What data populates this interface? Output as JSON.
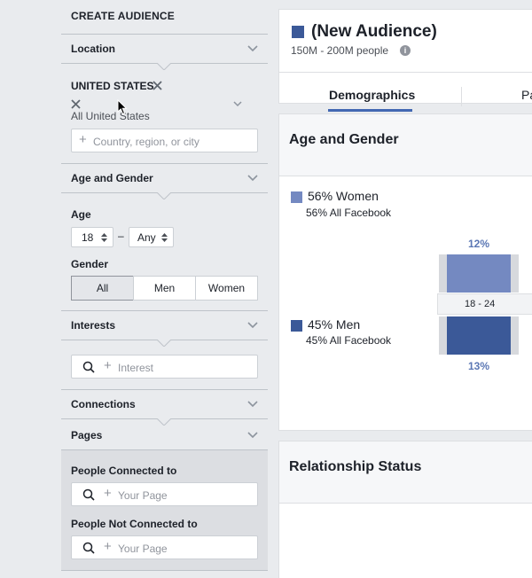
{
  "sidebar": {
    "title": "CREATE AUDIENCE",
    "location": {
      "header": "Location",
      "country": "UNITED STATES",
      "scope": "All United States",
      "placeholder": "Country, region, or city"
    },
    "age_gender": {
      "header": "Age and Gender",
      "age_label": "Age",
      "age_min": "18",
      "age_separator": "–",
      "age_max": "Any",
      "gender_label": "Gender",
      "gender_options": [
        "All",
        "Men",
        "Women"
      ],
      "gender_selected": "All"
    },
    "interests": {
      "header": "Interests",
      "placeholder": "Interest"
    },
    "connections": {
      "header": "Connections"
    },
    "pages": {
      "header": "Pages",
      "connected_label": "People Connected to",
      "connected_placeholder": "Your Page",
      "not_connected_label": "People Not Connected to",
      "not_connected_placeholder": "Your Page"
    }
  },
  "audience": {
    "name": "(New Audience)",
    "size": "150M - 200M people",
    "info_glyph": "i",
    "tabs": [
      "Demographics",
      "Pa"
    ],
    "active_tab": "Demographics"
  },
  "age_gender_card": {
    "title": "Age and Gender",
    "women": {
      "label": "56% Women",
      "sub": "56% All Facebook",
      "color": "#7489c1"
    },
    "men": {
      "label": "45% Men",
      "sub": "45% All Facebook",
      "color": "#3b5998"
    },
    "age_band": "18 - 24",
    "women_pct": "12%",
    "men_pct": "13%"
  },
  "relationship_card": {
    "title": "Relationship Status"
  },
  "icons": [
    "chevron-down-icon",
    "remove-x-icon",
    "plus-icon",
    "search-icon",
    "info-icon",
    "stepper-icon",
    "mouse-cursor-icon"
  ],
  "colors": {
    "accent": "#4267b2",
    "brand": "#3b5998"
  }
}
